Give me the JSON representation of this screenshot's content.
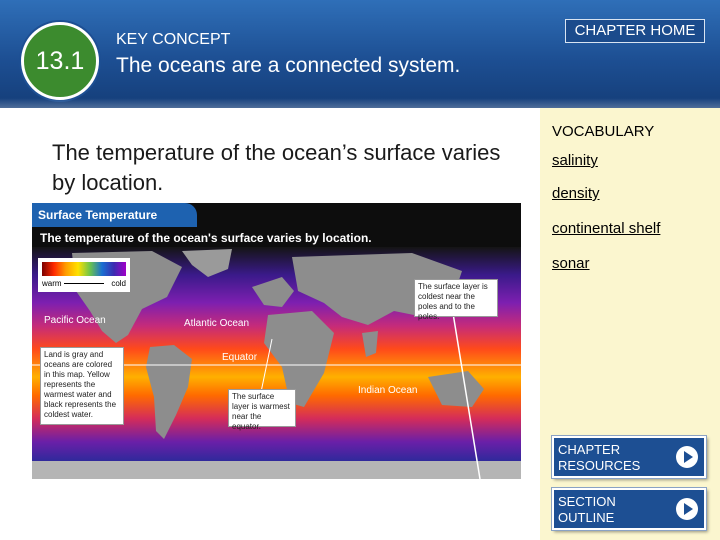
{
  "header": {
    "section_number": "13.1",
    "key_concept_label": "KEY CONCEPT",
    "concept_title": "The oceans are a connected system.",
    "chapter_home_label": "CHAPTER HOME"
  },
  "main": {
    "text": "The temperature of the ocean’s surface varies by location."
  },
  "figure": {
    "tab_title": "Surface Temperature",
    "caption": "The temperature of the ocean's surface varies by location.",
    "legend_warm": "warm",
    "legend_cold": "cold",
    "labels": {
      "pacific": "Pacific Ocean",
      "atlantic": "Atlantic Ocean",
      "equator": "Equator",
      "indian": "Indian Ocean"
    },
    "callouts": {
      "land": "Land is gray and oceans are colored in this map. Yellow represents the warmest water and black represents the coldest water.",
      "surface_poles": "The surface layer is coldest near the poles and to the poles.",
      "surface_equator": "The surface layer is warmest near the equator."
    }
  },
  "vocabulary": {
    "title": "VOCABULARY",
    "items": [
      "salinity",
      "density",
      "continental shelf",
      "sonar"
    ]
  },
  "buttons": {
    "chapter_resources": "CHAPTER RESOURCES",
    "section_outline": "SECTION OUTLINE"
  },
  "colors": {
    "header_blue": "#1d4f93",
    "badge_green": "#3c8b2e",
    "vocab_bg": "#fbf6cf"
  }
}
